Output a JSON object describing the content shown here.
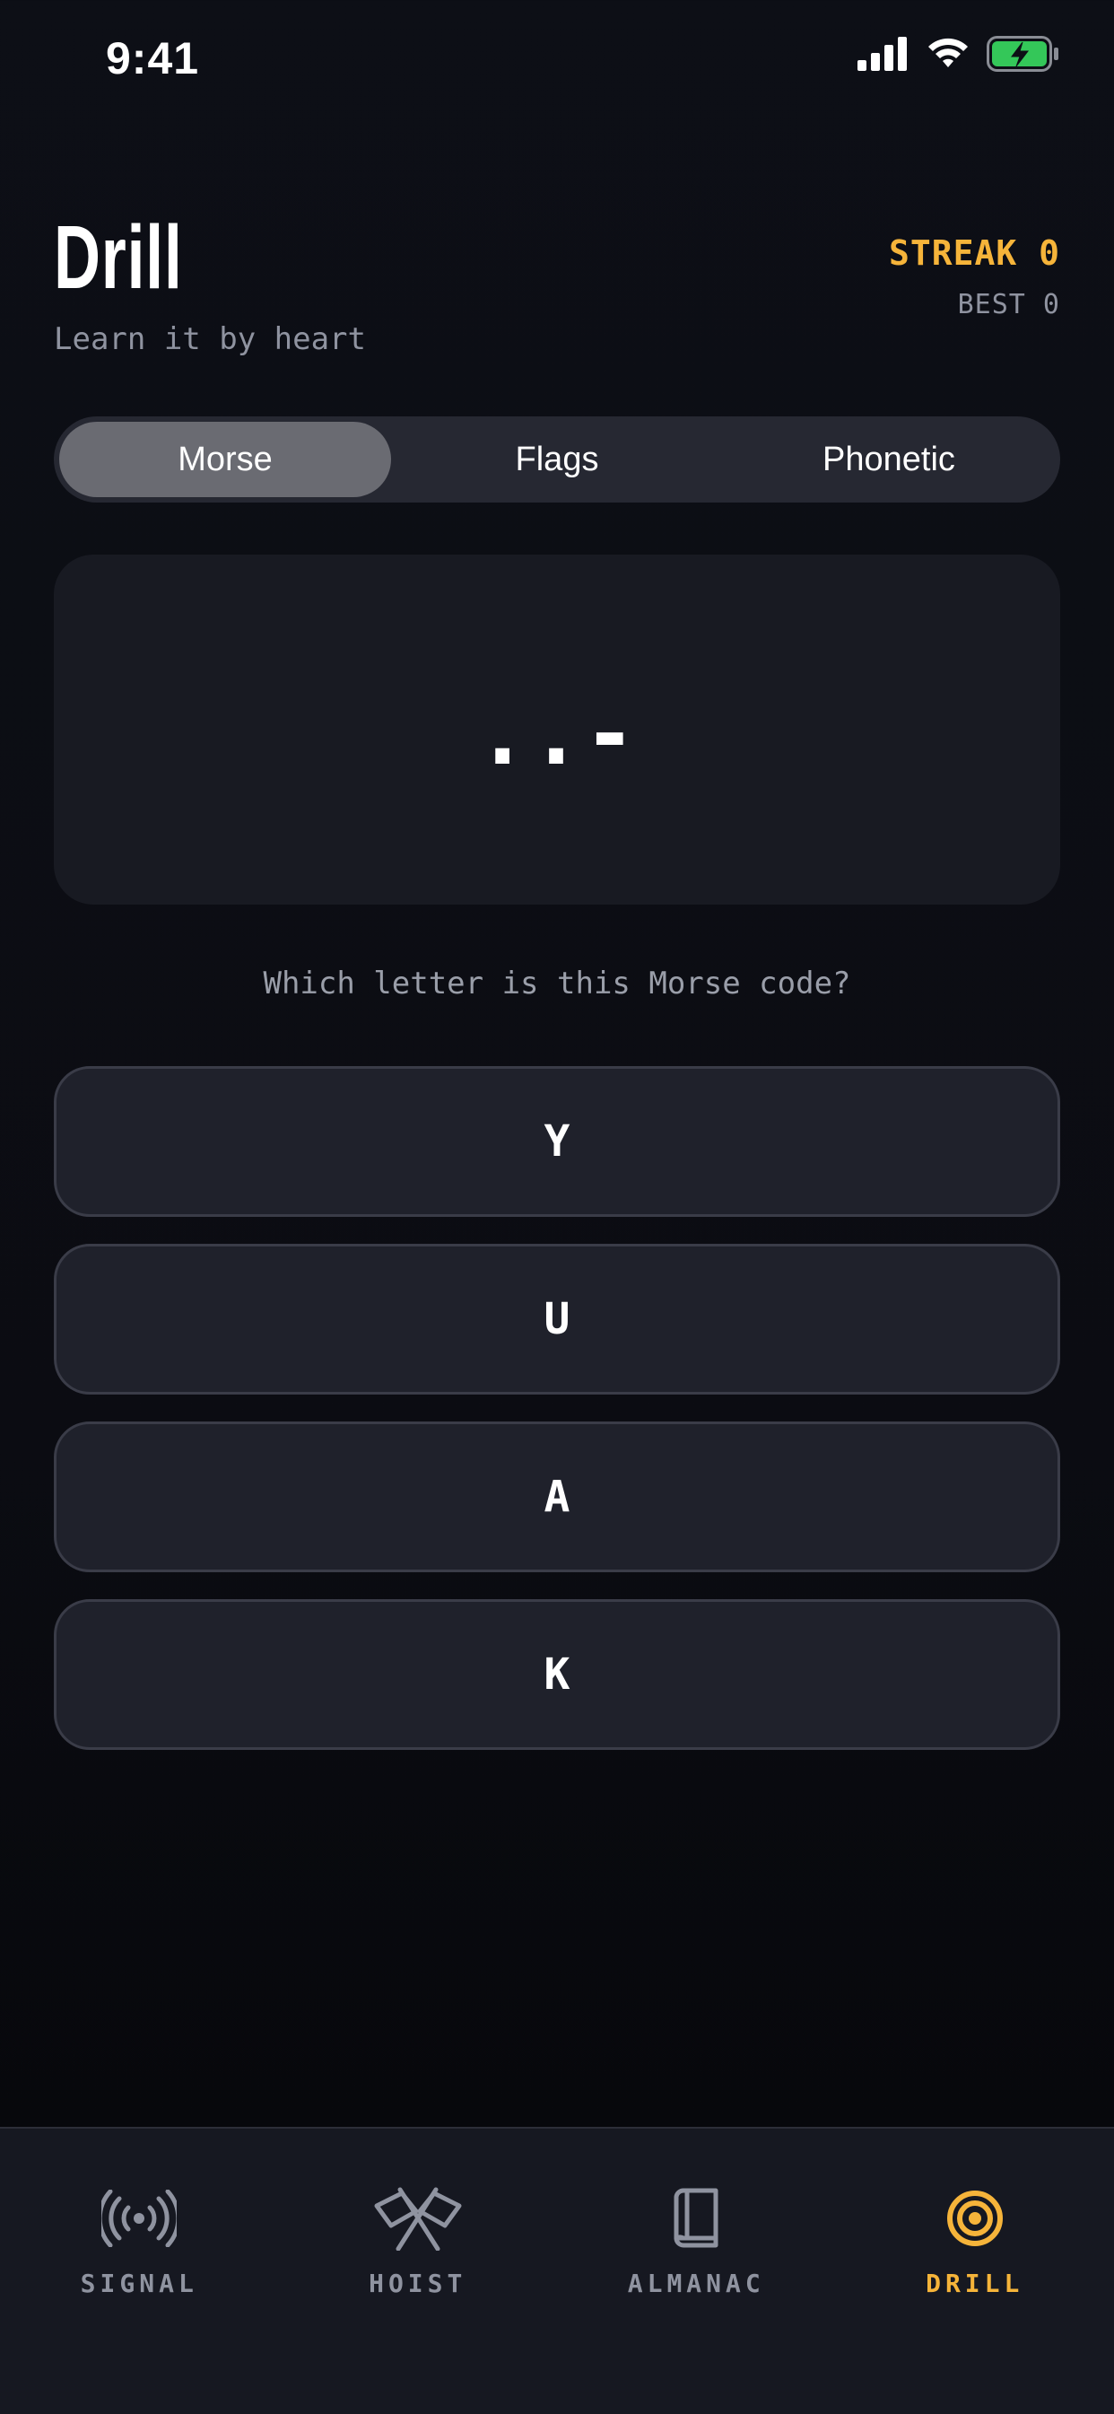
{
  "status_bar": {
    "time": "9:41"
  },
  "header": {
    "title": "Drill",
    "subtitle": "Learn it by heart",
    "streak": "STREAK 0",
    "best": "BEST 0"
  },
  "modes": [
    {
      "label": "Morse",
      "active": true
    },
    {
      "label": "Flags",
      "active": false
    },
    {
      "label": "Phonetic",
      "active": false
    }
  ],
  "prompt": {
    "code": "..-",
    "question": "Which letter is this Morse code?"
  },
  "answers": [
    {
      "label": "Y"
    },
    {
      "label": "U"
    },
    {
      "label": "A"
    },
    {
      "label": "K"
    }
  ],
  "tabs": [
    {
      "label": "SIGNAL",
      "icon": "broadcast-icon",
      "active": false
    },
    {
      "label": "HOIST",
      "icon": "crossed-flags-icon",
      "active": false
    },
    {
      "label": "ALMANAC",
      "icon": "book-icon",
      "active": false
    },
    {
      "label": "DRILL",
      "icon": "target-icon",
      "active": true
    }
  ],
  "colors": {
    "accent": "#f6b43a",
    "battery": "#34c759",
    "muted": "#8f93a0"
  }
}
